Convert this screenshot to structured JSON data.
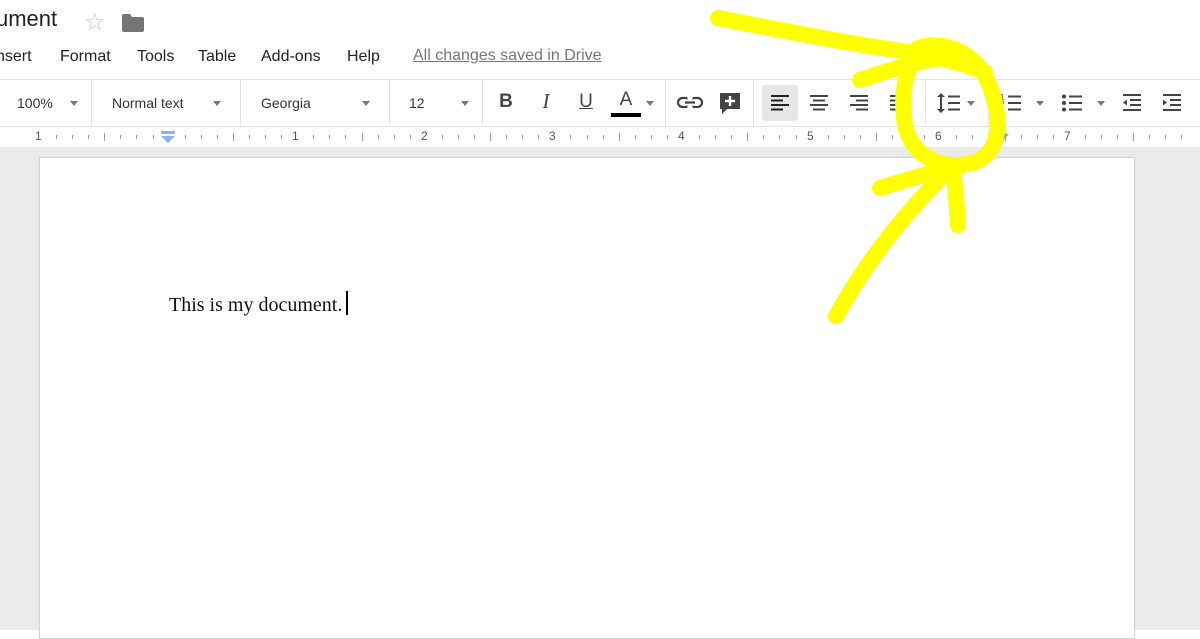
{
  "document": {
    "title": "ument",
    "body_text": "This is my document."
  },
  "menu": {
    "items": [
      "nsert",
      "Format",
      "Tools",
      "Table",
      "Add-ons",
      "Help"
    ],
    "save_status": "All changes saved in Drive"
  },
  "toolbar": {
    "zoom": "100%",
    "style": "Normal text",
    "font": "Georgia",
    "size": "12",
    "bold_label": "B",
    "italic_label": "I",
    "underline_label": "U",
    "text_color_label": "A",
    "text_color": "#000000",
    "active_alignment": "left"
  },
  "ruler": {
    "numbers": [
      "1",
      "1",
      "2",
      "3",
      "4",
      "5",
      "6",
      "7"
    ]
  },
  "annotation": {
    "color": "#ffff00",
    "shape": "hand-drawn circle with arrow around line-spacing button"
  }
}
